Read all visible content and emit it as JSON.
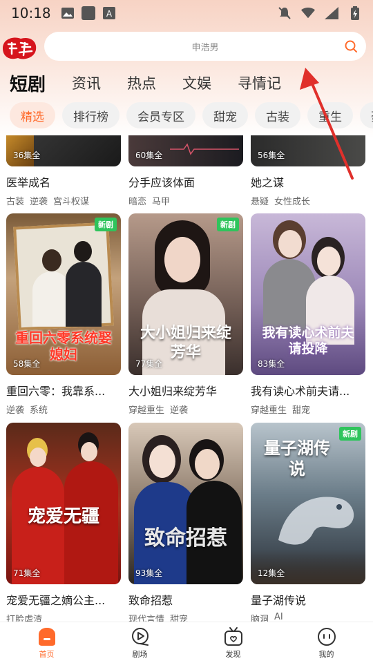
{
  "status_bar": {
    "time": "10:18"
  },
  "logo": {
    "text": ""
  },
  "search": {
    "placeholder": "申浩男"
  },
  "main_tabs": [
    "短剧",
    "资讯",
    "热点",
    "文娱",
    "寻情记"
  ],
  "chips": [
    "精选",
    "排行榜",
    "会员专区",
    "甜宠",
    "古装",
    "重生",
    "豪门"
  ],
  "cards": [
    {
      "title": "医举成名",
      "tags": [
        "古装",
        "逆袭",
        "宫斗权谋"
      ],
      "episodes": "36集全",
      "new": false
    },
    {
      "title": "分手应该体面",
      "tags": [
        "暗恋",
        "马甲"
      ],
      "episodes": "60集全",
      "new": false
    },
    {
      "title": "她之谋",
      "tags": [
        "悬疑",
        "女性成长"
      ],
      "episodes": "56集全",
      "new": false
    },
    {
      "title": "重回六零：我靠系...",
      "tags": [
        "逆袭",
        "系统"
      ],
      "episodes": "58集全",
      "new": true,
      "poster_text": "重回六零系统娶媳妇"
    },
    {
      "title": "大小姐归来绽芳华",
      "tags": [
        "穿越重生",
        "逆袭"
      ],
      "episodes": "77集全",
      "new": true,
      "poster_text": "大小姐归来绽芳华"
    },
    {
      "title": "我有读心术前夫请...",
      "tags": [
        "穿越重生",
        "甜宠"
      ],
      "episodes": "83集全",
      "new": false,
      "poster_text": "我有读心术前夫请投降"
    },
    {
      "title": "宠爱无疆之嫡公主...",
      "tags": [
        "打脸虐渣"
      ],
      "episodes": "71集全",
      "new": false,
      "poster_text": "宠爱无疆"
    },
    {
      "title": "致命招惹",
      "tags": [
        "现代言情",
        "甜宠"
      ],
      "episodes": "93集全",
      "new": false,
      "poster_text": "致命招惹"
    },
    {
      "title": "量子湖传说",
      "tags": [
        "脑洞",
        "AI"
      ],
      "episodes": "12集全",
      "new": true,
      "poster_text": "量子湖传说"
    }
  ],
  "new_badge_label": "新剧",
  "bottom_nav": [
    {
      "label": "首页",
      "icon": "home-icon",
      "active": true
    },
    {
      "label": "剧场",
      "icon": "theater-icon",
      "active": false
    },
    {
      "label": "发现",
      "icon": "discover-tv-icon",
      "active": false
    },
    {
      "label": "我的",
      "icon": "profile-icon",
      "active": false
    }
  ],
  "colors": {
    "accent": "#ff6a2b",
    "new_badge": "#2fc45c",
    "annotation": "#e0302b"
  }
}
